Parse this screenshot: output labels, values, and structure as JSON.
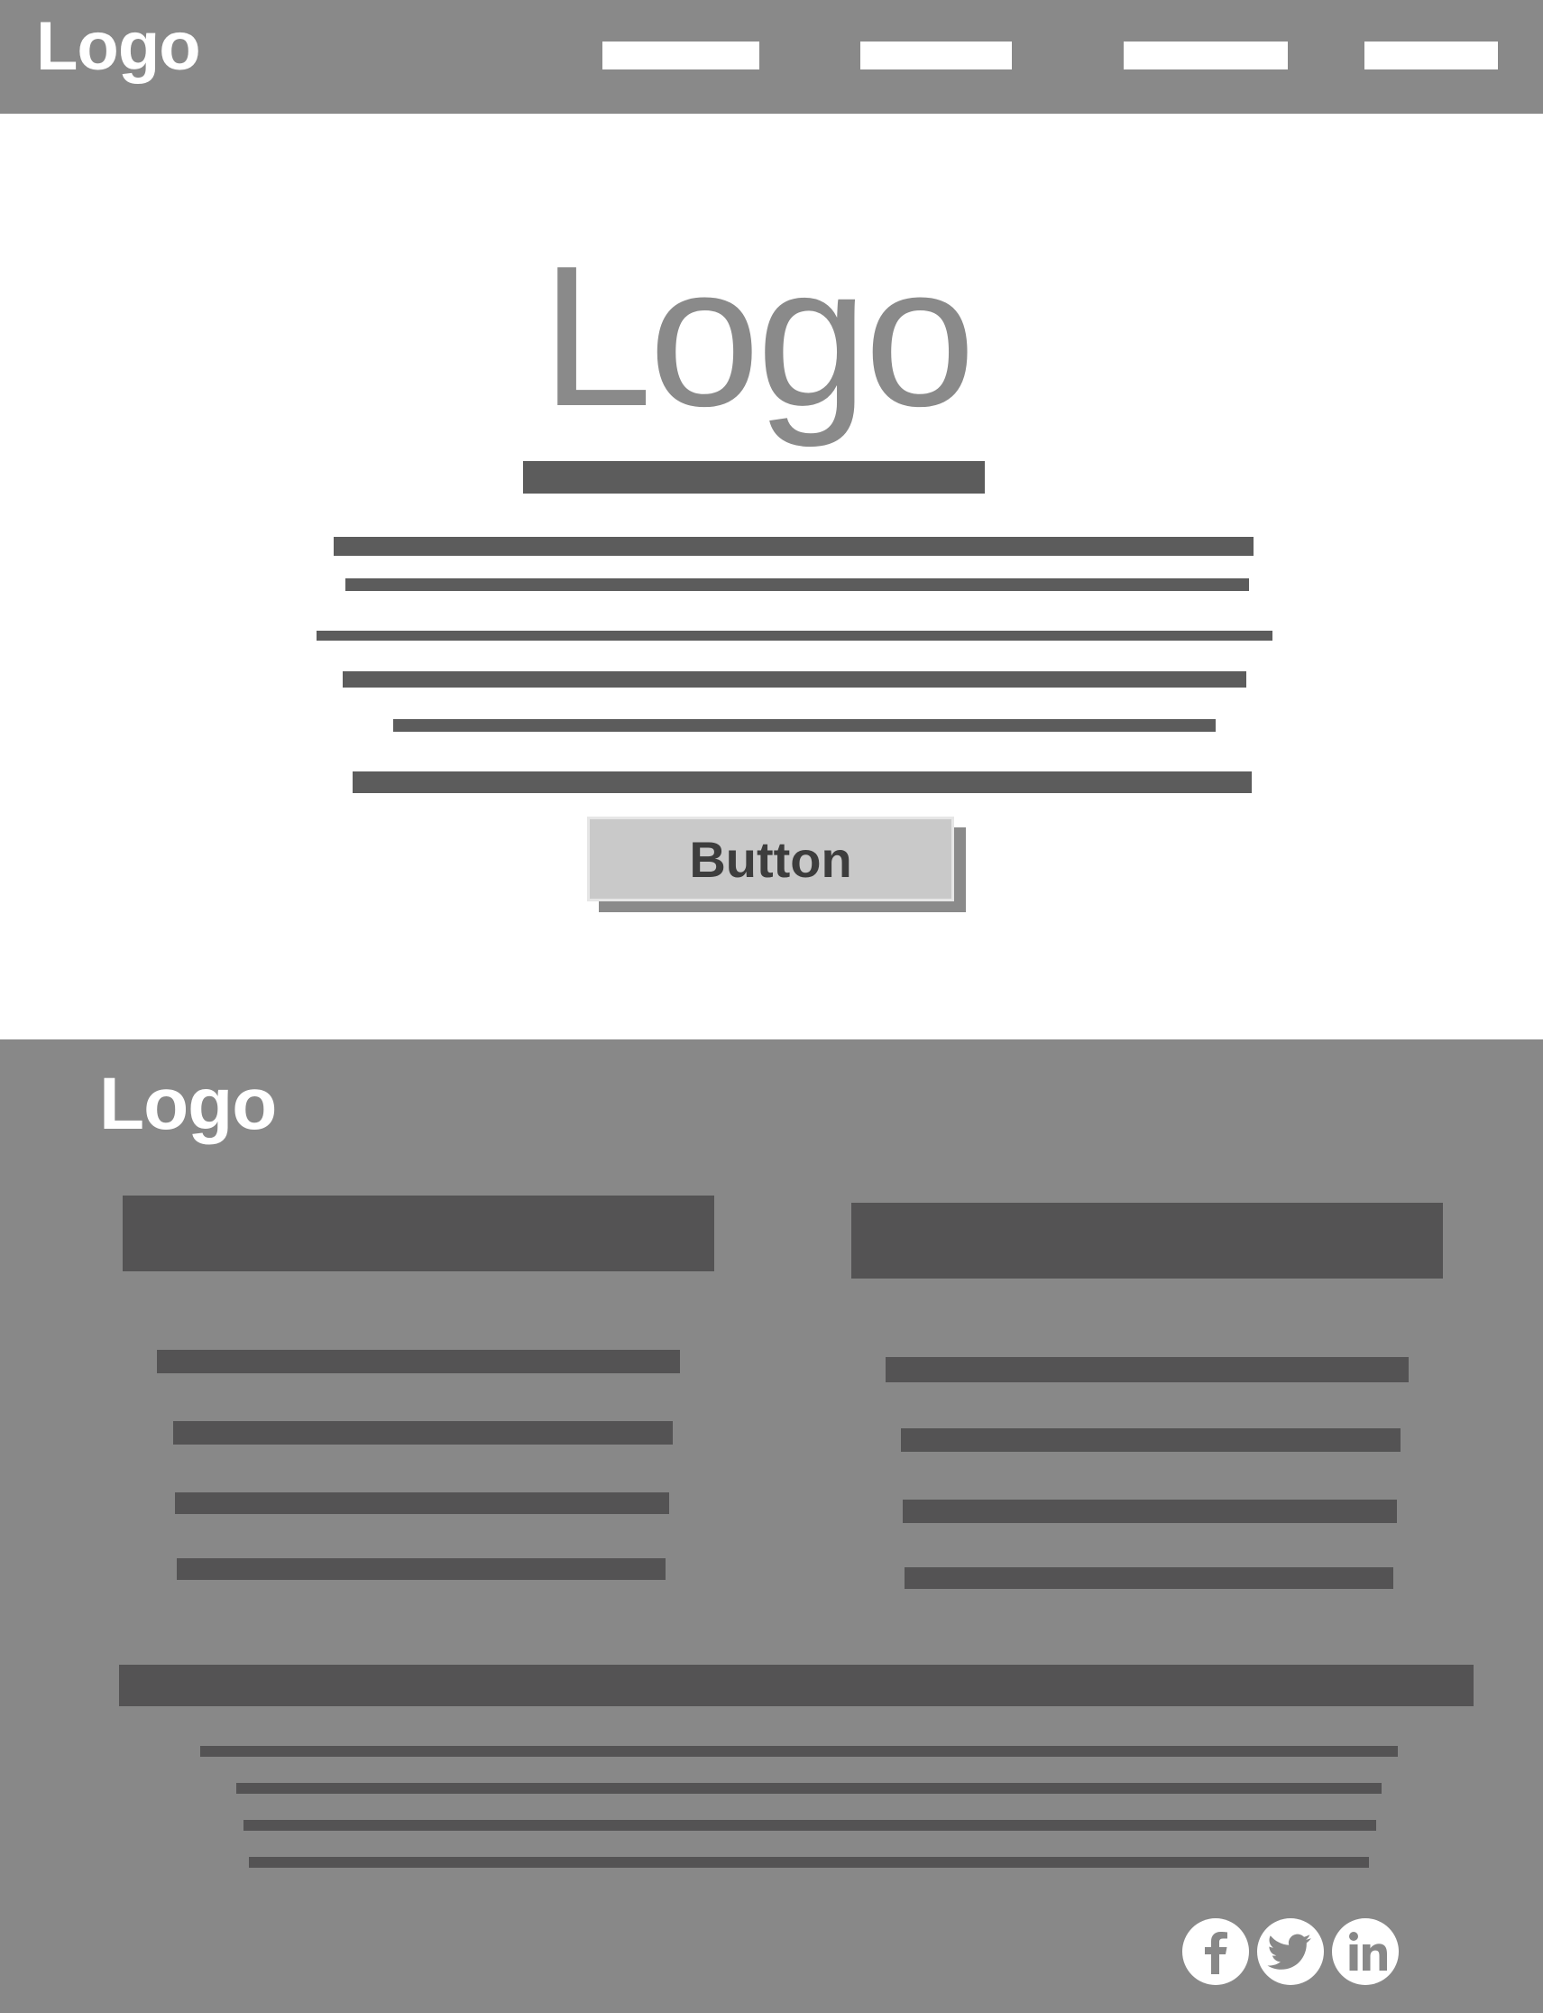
{
  "header": {
    "logo": "Logo",
    "nav_items": [
      "",
      "",
      "",
      ""
    ]
  },
  "hero": {
    "logo": "Logo",
    "button_label": "Button"
  },
  "footer": {
    "logo": "Logo"
  },
  "social": {
    "icons": [
      "facebook-icon",
      "twitter-icon",
      "linkedin-icon"
    ]
  },
  "colors": {
    "header_bg": "#898989",
    "footer_bg": "#888888",
    "text_placeholder": "#5c5c5c",
    "footer_placeholder": "#545354",
    "button_bg": "#c9c9c9"
  }
}
